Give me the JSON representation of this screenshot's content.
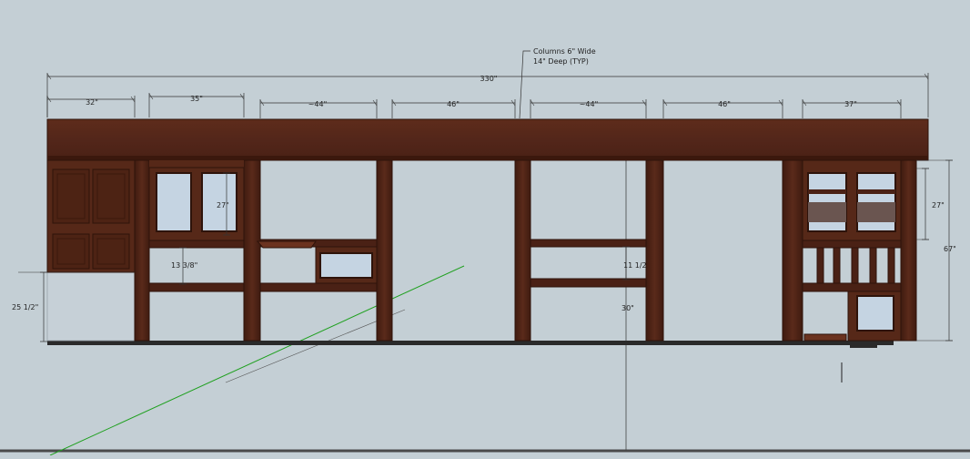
{
  "drawing": {
    "callout": {
      "line1": "Columns 6\" Wide",
      "line2": "14\" Deep (TYP)"
    },
    "dims": {
      "overall": "330\"",
      "bay1": "32\"",
      "bay2": "35\"",
      "bay3": "~44\"",
      "bay4": "46\"",
      "bay5": "~44\"",
      "bay6": "46\"",
      "bay7": "37\"",
      "upper_cabinet_left": "27\"",
      "upper_cabinet_right": "27\"",
      "shelf_gap_left": "13 3/8\"",
      "shelf_gap_mid": "11 1/2",
      "counter_height": "25 1/2\"",
      "opening_height": "30\"",
      "total_height": "67\""
    },
    "colors": {
      "background": "#c4cfd5",
      "wood": "#5a2a1a",
      "wood_dark": "#3e1a0e",
      "glass": "#c5d4e2",
      "dim_line": "#333333",
      "axis_green": "#1fa01f"
    }
  }
}
